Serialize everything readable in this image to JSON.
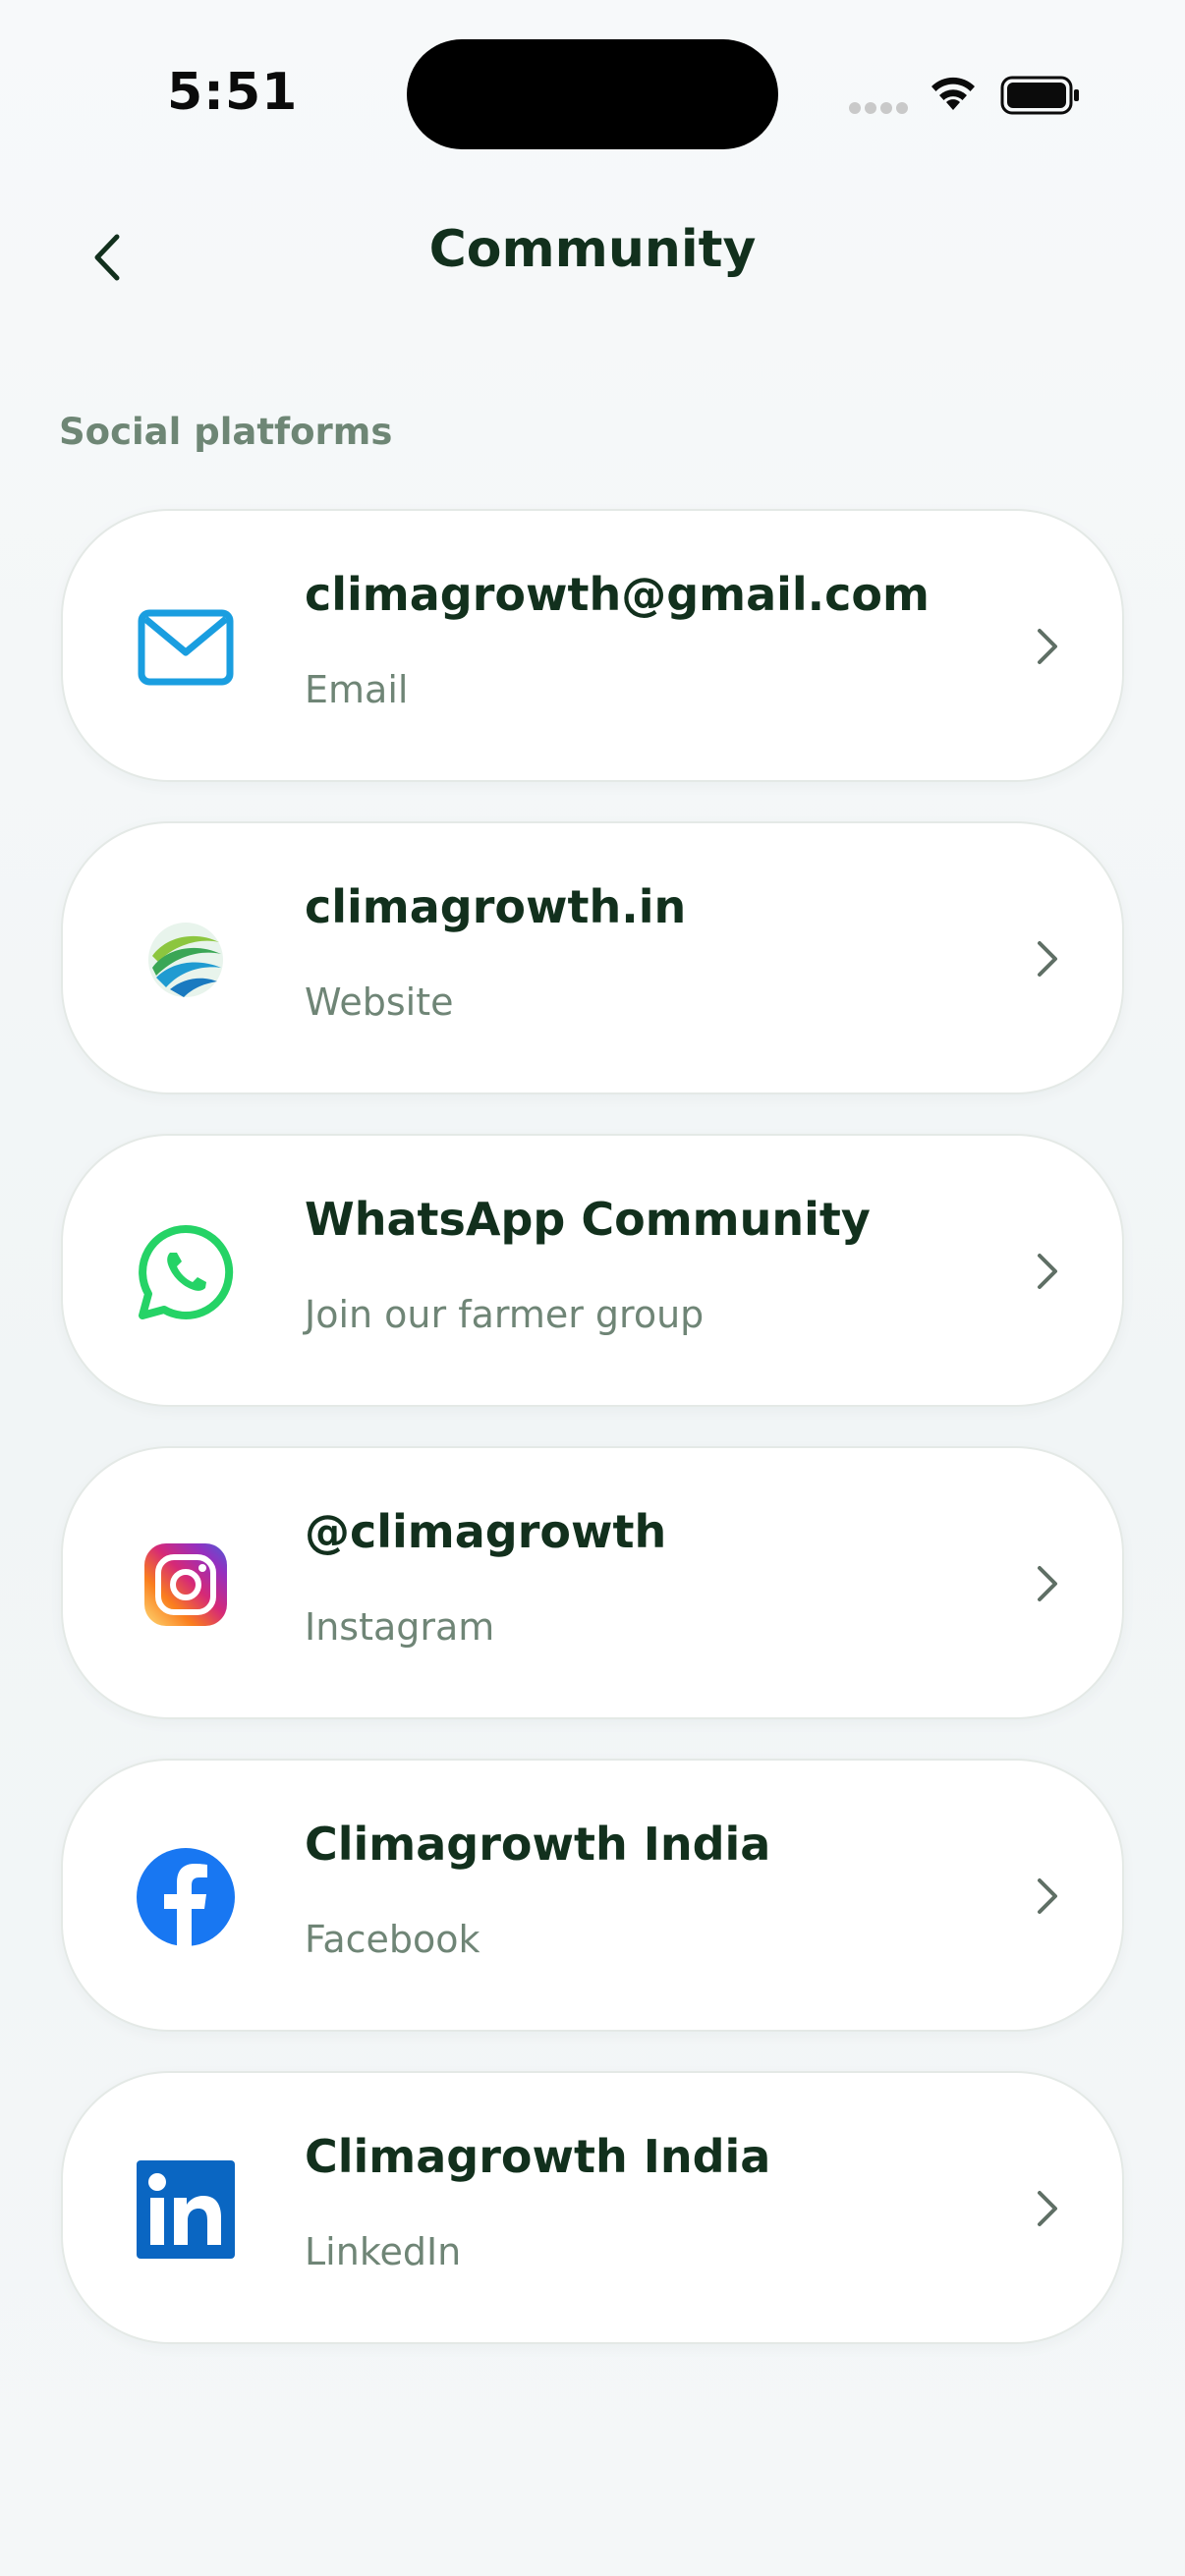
{
  "status_bar": {
    "time": "5:51"
  },
  "header": {
    "title": "Community",
    "back_icon": "chevron-left-icon"
  },
  "section": {
    "label": "Social platforms"
  },
  "platforms": [
    {
      "title": "climagrowth@gmail.com",
      "subtitle": "Email",
      "icon": "email-icon",
      "color": "#1a9ee0"
    },
    {
      "title": "climagrowth.in",
      "subtitle": "Website",
      "icon": "website-logo-icon",
      "color": "#4caf50"
    },
    {
      "title": "WhatsApp Community",
      "subtitle": "Join our farmer group",
      "icon": "whatsapp-icon",
      "color": "#25d366"
    },
    {
      "title": "@climagrowth",
      "subtitle": "Instagram",
      "icon": "instagram-icon",
      "color": "#e1306c"
    },
    {
      "title": "Climagrowth India",
      "subtitle": "Facebook",
      "icon": "facebook-icon",
      "color": "#1877f2"
    },
    {
      "title": "Climagrowth India",
      "subtitle": "LinkedIn",
      "icon": "linkedin-icon",
      "color": "#0a66c2"
    }
  ],
  "colors": {
    "title_text": "#12301d",
    "muted_text": "#6f8576",
    "card_border": "#e4e9e6"
  }
}
